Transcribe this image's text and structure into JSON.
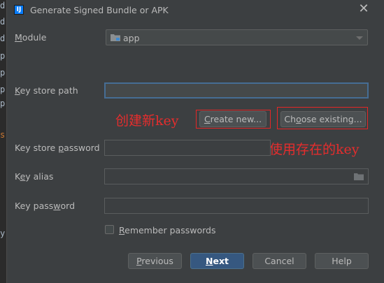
{
  "window": {
    "title": "Generate Signed Bundle or APK",
    "icon_text": "IJ",
    "close_symbol": "✕"
  },
  "background_editor": {
    "chars": [
      "d",
      "d",
      "d",
      "p",
      "p",
      "p",
      "p",
      "p",
      "s",
      "y"
    ]
  },
  "form": {
    "module": {
      "label_mnemonic": "M",
      "label_rest": "odule",
      "value": "app",
      "icon": "folder-module-icon"
    },
    "key_store_path": {
      "label_mnemonic": "K",
      "label_rest": "ey store path",
      "value": ""
    },
    "create_new": {
      "label_mnemonic": "C",
      "label_rest": "reate new..."
    },
    "choose_existing": {
      "label_pre": "Ch",
      "label_mnemonic": "o",
      "label_rest": "ose existing..."
    },
    "key_store_password": {
      "label_pre": "Key store ",
      "label_mnemonic": "p",
      "label_rest": "assword",
      "value": ""
    },
    "key_alias": {
      "label_pre": "K",
      "label_mnemonic": "e",
      "label_rest": "y alias",
      "value": "",
      "icon": "folder-browse-icon"
    },
    "key_password": {
      "label_pre": "Key pass",
      "label_mnemonic": "w",
      "label_rest": "ord",
      "value": ""
    },
    "remember_passwords": {
      "label_mnemonic": "R",
      "label_rest": "emember passwords",
      "checked": false
    }
  },
  "annotations": {
    "create_new_note": "创建新key",
    "use_existing_note": "使用存在的key",
    "color": "#e52d2d"
  },
  "buttons": {
    "previous": {
      "mnemonic": "P",
      "rest": "revious"
    },
    "next": {
      "mnemonic": "N",
      "rest": "ext"
    },
    "cancel": {
      "label": "Cancel"
    },
    "help": {
      "label": "Help"
    }
  },
  "colors": {
    "dialog_bg": "#3c3f41",
    "field_bg": "#45494a",
    "primary_button": "#365880",
    "focus_border": "#466d94"
  }
}
